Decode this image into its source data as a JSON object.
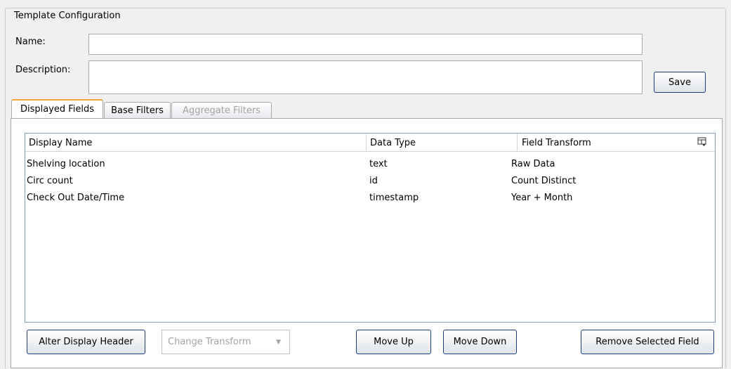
{
  "config": {
    "legend": "Template Configuration",
    "name_label": "Name:",
    "name_value": "",
    "description_label": "Description:",
    "description_value": "",
    "save_label": "Save"
  },
  "tabs": [
    {
      "label": "Displayed Fields",
      "state": "active"
    },
    {
      "label": "Base Filters",
      "state": "normal"
    },
    {
      "label": "Aggregate Filters",
      "state": "disabled"
    }
  ],
  "table": {
    "columns": [
      "Display Name",
      "Data Type",
      "Field Transform"
    ],
    "column_picker_icon": "column-picker-icon",
    "rows": [
      [
        "Shelving location",
        "text",
        "Raw Data"
      ],
      [
        "Circ count",
        "id",
        "Count Distinct"
      ],
      [
        "Check Out Date/Time",
        "timestamp",
        "Year + Month"
      ]
    ]
  },
  "actions": {
    "alter_header": "Alter Display Header",
    "change_transform": "Change Transform",
    "move_up": "Move Up",
    "move_down": "Move Down",
    "remove_field": "Remove Selected Field"
  }
}
